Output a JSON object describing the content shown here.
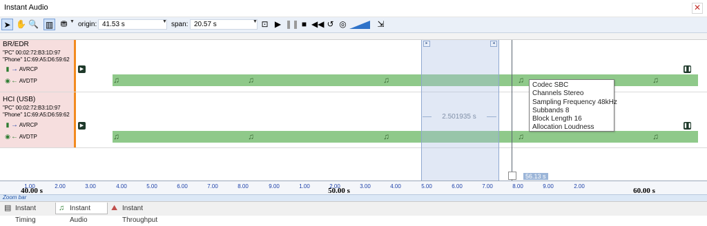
{
  "window": {
    "title": "Instant Audio",
    "close_glyph": "✕"
  },
  "toolbar": {
    "origin_label": "origin:",
    "origin_value": "41.53 s",
    "span_label": "span:",
    "span_value": "20.57 s",
    "icons": [
      "pointer-icon",
      "hand-icon",
      "zoom-icon",
      "panel-icon",
      "filter-icon",
      "zoom-fit-icon",
      "play-icon",
      "pause-icon",
      "stop-icon",
      "rewind-icon",
      "loop-icon",
      "audio-output-icon",
      "volume-icon",
      "export-icon"
    ]
  },
  "rows": [
    {
      "title": "BR/EDR",
      "device1": "\"PC\" 00:02:72:B3:1D:97",
      "device2": "\"Phone\" 1C:69:A5:D6:59:62",
      "protocols": [
        {
          "name": "AVRCP",
          "arrow": "→"
        },
        {
          "name": "AVDTP",
          "arrow": "←"
        }
      ]
    },
    {
      "title": "HCI (USB)",
      "device1": "\"PC\" 00:02:72:B3:1D:97",
      "device2": "\"Phone\" 1C:69:A5:D6:59:62",
      "protocols": [
        {
          "name": "AVRCP",
          "arrow": "→"
        },
        {
          "name": "AVDTP",
          "arrow": "←"
        }
      ]
    }
  ],
  "selection": {
    "span_text": "2.501935 s"
  },
  "cursor": {
    "time_text": "56.13 s"
  },
  "tooltip": {
    "lines": [
      "Codec SBC",
      "Channels Stereo",
      "Sampling Frequency 48kHz",
      "Subbands 8",
      "Block Length 16",
      "Allocation Loudness"
    ]
  },
  "axis": {
    "ticks": [
      "1.00",
      "2.00",
      "3.00",
      "4.00",
      "5.00",
      "6.00",
      "7.00",
      "8.00",
      "9.00",
      "1.00",
      "2.00",
      "3.00",
      "4.00",
      "5.00",
      "6.00",
      "7.00",
      "8.00",
      "9.00",
      "2.00"
    ],
    "major": [
      "40.00 s",
      "50.00 s",
      "60.00 s"
    ]
  },
  "zoombar": {
    "label": "Zoom bar"
  },
  "tabs": [
    {
      "label": "Instant Timing",
      "active": false
    },
    {
      "label": "Instant Audio",
      "active": true
    },
    {
      "label": "Instant Throughput",
      "active": false
    }
  ],
  "colors": {
    "audio_bar": "#8fc98a",
    "row_label_bg": "#f6dede",
    "row_accent": "#f28a1e",
    "selection": "#aabee1",
    "axis_text": "#1a3fa8"
  }
}
